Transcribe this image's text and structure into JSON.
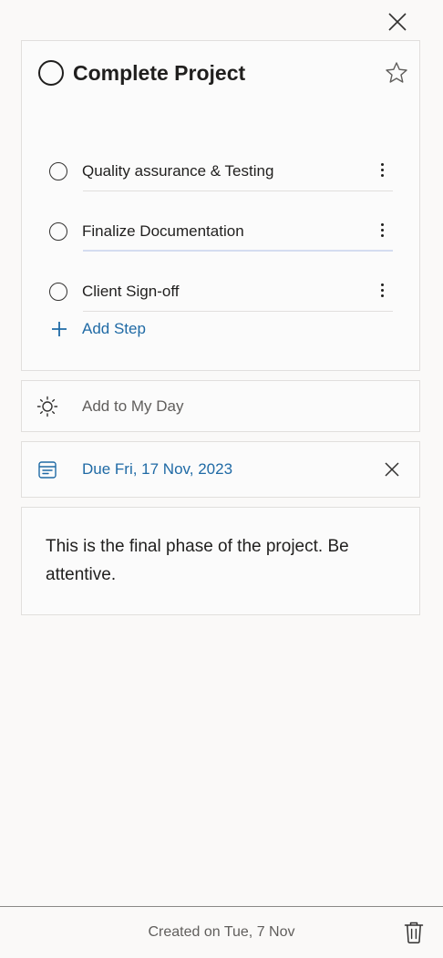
{
  "task": {
    "title": "Complete Project",
    "steps": [
      {
        "label": "Quality assurance & Testing"
      },
      {
        "label": "Finalize Documentation"
      },
      {
        "label": "Client Sign-off"
      }
    ],
    "add_step_label": "Add Step"
  },
  "my_day": {
    "label": "Add to My Day"
  },
  "due": {
    "label": "Due Fri, 17 Nov, 2023"
  },
  "note": {
    "text": "This is the final phase of the project. Be attentive."
  },
  "footer": {
    "created": "Created on Tue, 7 Nov"
  },
  "icons": {
    "close": "close-icon",
    "star": "star-icon",
    "more": "more-vertical-icon",
    "plus": "plus-icon",
    "sun": "sun-icon",
    "calendar": "calendar-icon",
    "trash": "trash-icon"
  },
  "colors": {
    "accent": "#1f6aa5",
    "background": "#faf9f8",
    "border": "#e1dfdd"
  }
}
